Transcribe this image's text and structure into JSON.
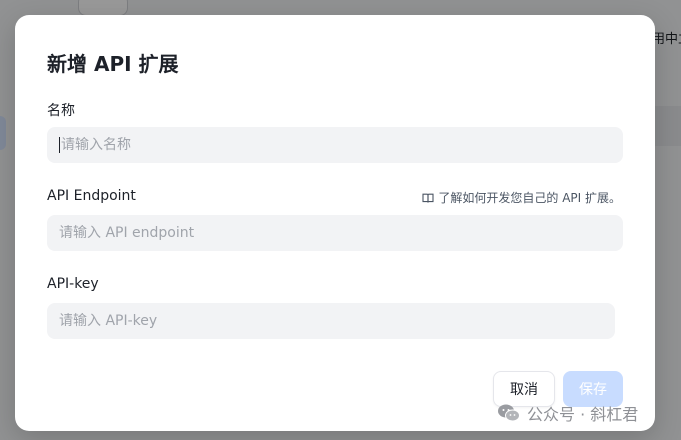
{
  "background": {
    "right_text": "用中立"
  },
  "dialog": {
    "title": "新增 API 扩展",
    "fields": [
      {
        "label": "名称",
        "value": "",
        "placeholder": "请输入名称"
      },
      {
        "label": "API Endpoint",
        "value": "",
        "placeholder": "请输入 API endpoint"
      },
      {
        "label": "API-key",
        "value": "",
        "placeholder": "请输入 API-key"
      }
    ],
    "doc_link": {
      "icon": "book-icon",
      "text": "了解如何开发您自己的 API 扩展。"
    },
    "cancel_label": "取消",
    "save_label": "保存"
  },
  "watermark": {
    "icon": "wechat-icon",
    "text": "公众号 · 斜杠君"
  },
  "colors": {
    "primary_disabled": "#c8dcff",
    "input_bg": "#f2f3f5",
    "text": "#1d2129",
    "placeholder": "#a0a4ab"
  }
}
